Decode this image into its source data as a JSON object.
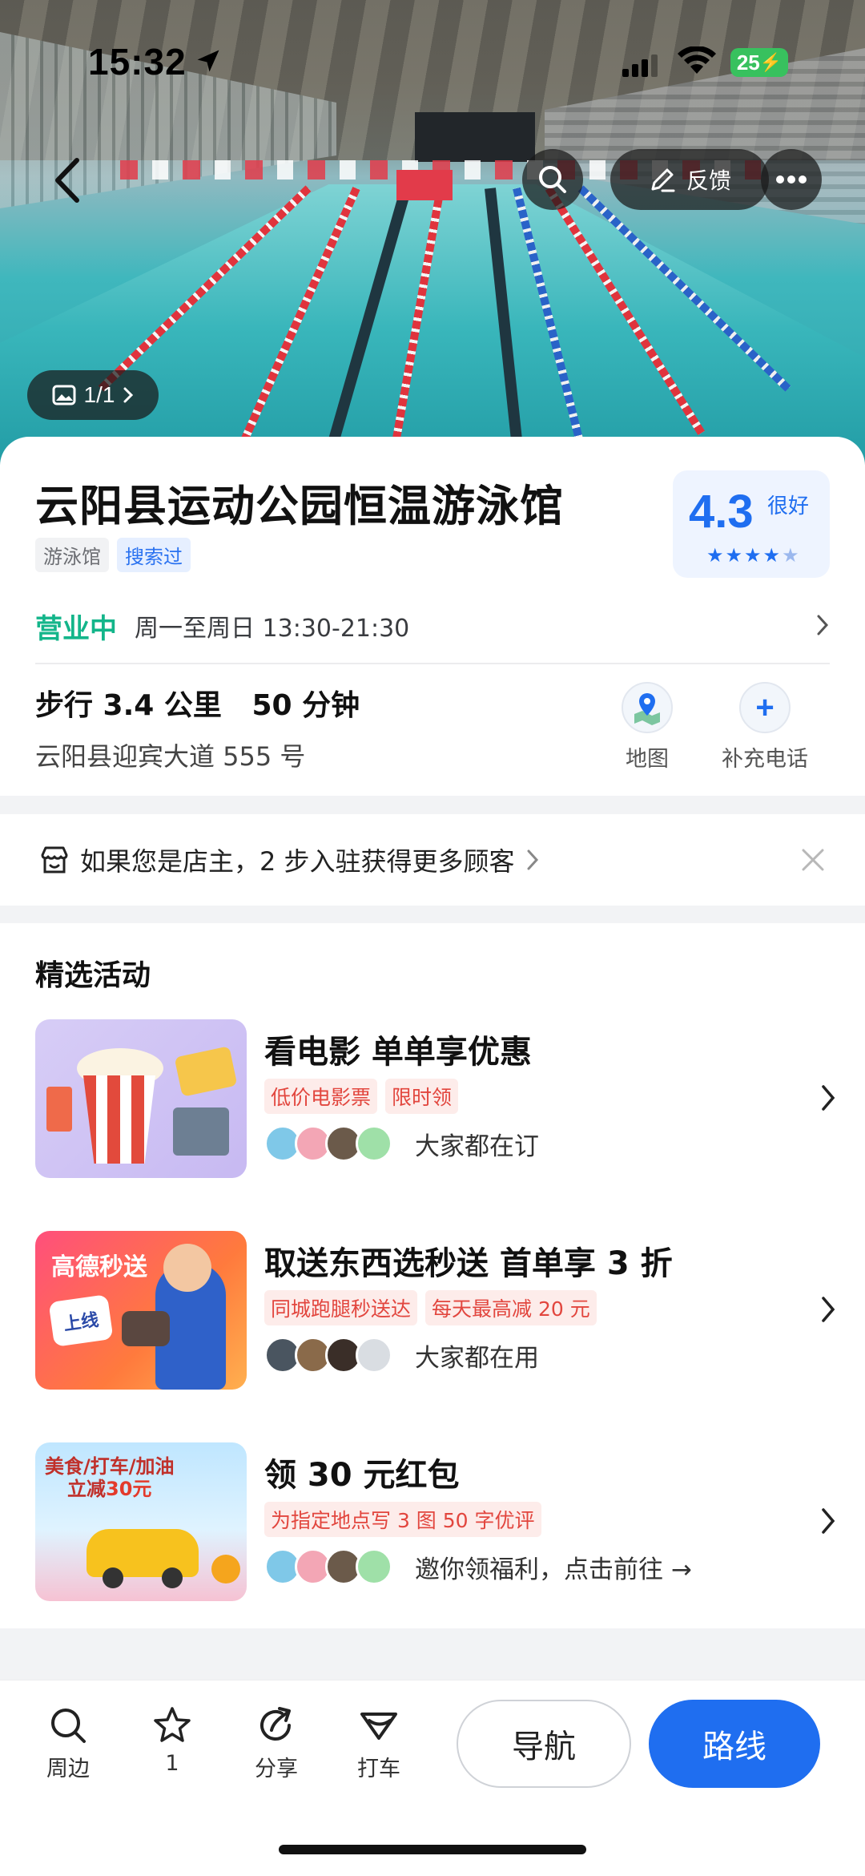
{
  "status_bar": {
    "time": "15:32",
    "battery": "25"
  },
  "hero": {
    "feedback_label": "反馈",
    "photo_counter": "1/1"
  },
  "poi": {
    "name": "云阳县运动公园恒温游泳馆",
    "tags": [
      "游泳馆",
      "搜索过"
    ],
    "rating": {
      "score": "4.3",
      "word": "很好",
      "stars": 4.3
    },
    "open_status": "营业中",
    "hours": "周一至周日 13:30-21:30",
    "distance": "步行 3.4 公里   50 分钟",
    "address": "云阳县迎宾大道 555 号",
    "actions": {
      "map_label": "地图",
      "phone_label": "补充电话"
    }
  },
  "owner_banner": {
    "text": "如果您是店主，2 步入驻获得更多顾客"
  },
  "activities": {
    "title": "精选活动",
    "items": [
      {
        "title": "看电影 单单享优惠",
        "tags": [
          "低价电影票",
          "限时领"
        ],
        "social": "大家都在订"
      },
      {
        "title": "取送东西选秒送 首单享 3 折",
        "tags": [
          "同城跑腿秒送达",
          "每天最高减 20 元"
        ],
        "social": "大家都在用",
        "thumb_brand": "高德秒送",
        "thumb_badge": "上线"
      },
      {
        "title": "领 30 元红包",
        "tags": [
          "为指定地点写 3 图 50 字优评"
        ],
        "social": "邀你领福利，点击前往 →",
        "thumb_line1": "美食/打车/加油",
        "thumb_line2_a": "立减",
        "thumb_line2_b": "30元"
      }
    ]
  },
  "bottom_bar": {
    "nearby": "周边",
    "favorite_count": "1",
    "share": "分享",
    "taxi": "打车",
    "navigate": "导航",
    "route": "路线"
  },
  "colors": {
    "accent": "#1f6ef0",
    "open": "#13b58a",
    "promo_red": "#e2463e"
  }
}
